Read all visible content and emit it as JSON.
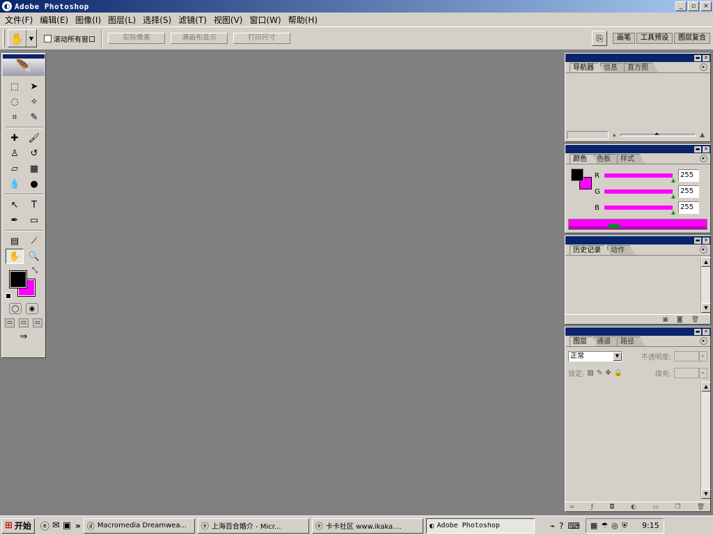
{
  "window": {
    "title": "Adobe Photoshop",
    "buttons": [
      "_",
      "▫",
      "×"
    ]
  },
  "menu": [
    "文件(F)",
    "编辑(E)",
    "图像(I)",
    "图层(L)",
    "选择(S)",
    "滤镜(T)",
    "视图(V)",
    "窗口(W)",
    "帮助(H)"
  ],
  "options": {
    "checkbox_label": "滚动所有窗口",
    "buttons": [
      "实际像素",
      "满画布显示",
      "打印尺寸"
    ],
    "well_tabs": [
      "画笔",
      "工具预设",
      "图层复合"
    ]
  },
  "colors": {
    "foreground": "#000000",
    "background": "#ff00ff",
    "workspace": "#808080",
    "titlebar": "#0a246a"
  },
  "navigator_panel": {
    "tabs": [
      "导航器",
      "信息",
      "直方图"
    ]
  },
  "color_panel": {
    "tabs": [
      "颜色",
      "色板",
      "样式"
    ],
    "channels": [
      {
        "label": "R",
        "value": "255"
      },
      {
        "label": "G",
        "value": "255"
      },
      {
        "label": "B",
        "value": "255"
      }
    ]
  },
  "history_panel": {
    "tabs": [
      "历史记录",
      "动作"
    ]
  },
  "layers_panel": {
    "tabs": [
      "图层",
      "通道",
      "路径"
    ],
    "blend_mode": "正常",
    "opacity_label": "不透明度:",
    "lock_label": "锁定:",
    "fill_label": "填充:"
  },
  "taskbar": {
    "start_label": "开始",
    "tasks": [
      {
        "label": "Macromedia Dreamwea...",
        "icon": "dreamweaver-icon"
      },
      {
        "label": "上海百合婚介 - Micr...",
        "icon": "ie-icon"
      },
      {
        "label": "卡卡社区 www.ikaka....",
        "icon": "ie-icon"
      },
      {
        "label": "Adobe Photoshop",
        "icon": "photoshop-icon"
      }
    ],
    "clock": "9:15"
  }
}
